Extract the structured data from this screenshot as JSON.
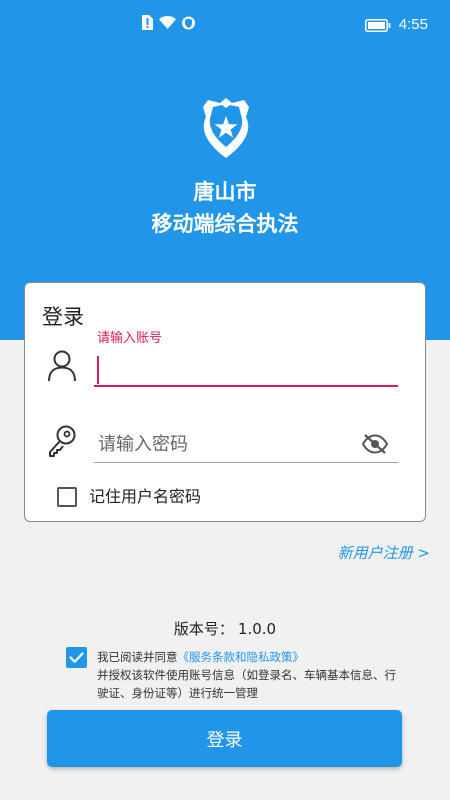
{
  "status_bar": {
    "time": "4:55",
    "icons": [
      "sim-alert-icon",
      "wifi-icon",
      "vpn-shield-icon",
      "battery-icon"
    ]
  },
  "app": {
    "title_line1": "唐山市",
    "title_line2": "移动端综合执法",
    "logo_icon": "police-badge-star-icon"
  },
  "login_card": {
    "heading": "登录",
    "account_label": "请输入账号",
    "account_value": "",
    "password_placeholder": "请输入密码",
    "remember_label": "记住用户名密码",
    "remember_checked": false
  },
  "register_link": "新用户注册 >",
  "version": {
    "label": "版本号：",
    "value": "1.0.0"
  },
  "agreement": {
    "checked": true,
    "prefix": "我已阅读并同意",
    "policy_link": "《服务条款和隐私政策》",
    "suffix": "并授权该软件使用账号信息（如登录名、车辆基本信息、行驶证、身份证等）进行统一管理"
  },
  "login_button": "登录",
  "colors": {
    "primary": "#2196e8",
    "accent": "#d81b60",
    "background": "#f1f1f1"
  }
}
